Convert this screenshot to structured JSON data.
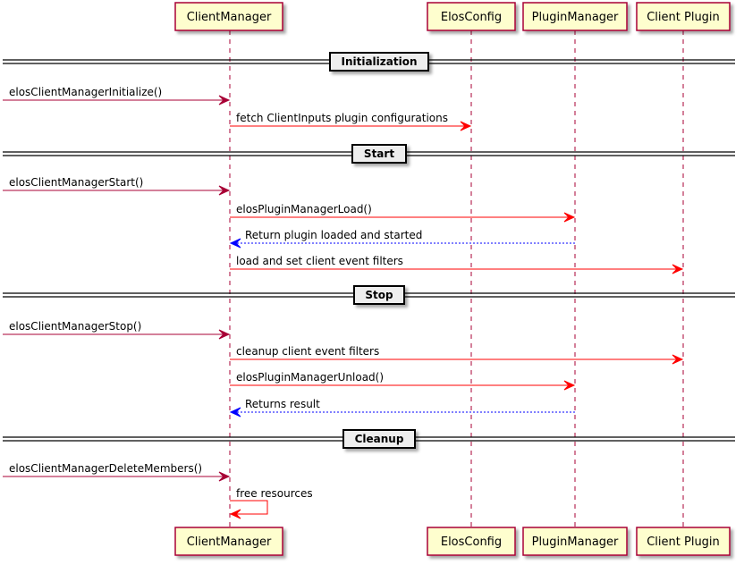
{
  "diagram": {
    "type": "sequence",
    "participants": [
      {
        "id": "cm",
        "label": "ClientManager"
      },
      {
        "id": "ec",
        "label": "ElosConfig"
      },
      {
        "id": "pm",
        "label": "PluginManager"
      },
      {
        "id": "cp",
        "label": "Client Plugin"
      }
    ],
    "colors": {
      "participant_fill": "#FEFECE",
      "participant_border": "#A80036",
      "lifeline": "#A80036",
      "external_arrow": "#A80036",
      "call_arrow": "#FF0000",
      "return_arrow": "#0000FF",
      "divider_fill": "#EEEEEE"
    },
    "steps": [
      {
        "kind": "divider",
        "label": "Initialization"
      },
      {
        "kind": "message",
        "from": "external",
        "to": "cm",
        "label": "elosClientManagerInitialize()",
        "style": "external"
      },
      {
        "kind": "message",
        "from": "cm",
        "to": "ec",
        "label": "fetch ClientInputs plugin configurations",
        "style": "call"
      },
      {
        "kind": "divider",
        "label": "Start"
      },
      {
        "kind": "message",
        "from": "external",
        "to": "cm",
        "label": "elosClientManagerStart()",
        "style": "external"
      },
      {
        "kind": "message",
        "from": "cm",
        "to": "pm",
        "label": "elosPluginManagerLoad()",
        "style": "call"
      },
      {
        "kind": "message",
        "from": "pm",
        "to": "cm",
        "label": "Return plugin loaded and started",
        "style": "return"
      },
      {
        "kind": "message",
        "from": "cm",
        "to": "cp",
        "label": "load and set client event filters",
        "style": "call"
      },
      {
        "kind": "divider",
        "label": "Stop"
      },
      {
        "kind": "message",
        "from": "external",
        "to": "cm",
        "label": "elosClientManagerStop()",
        "style": "external"
      },
      {
        "kind": "message",
        "from": "cm",
        "to": "cp",
        "label": "cleanup client event filters",
        "style": "call"
      },
      {
        "kind": "message",
        "from": "cm",
        "to": "pm",
        "label": "elosPluginManagerUnload()",
        "style": "call"
      },
      {
        "kind": "message",
        "from": "pm",
        "to": "cm",
        "label": "Returns result",
        "style": "return"
      },
      {
        "kind": "divider",
        "label": "Cleanup"
      },
      {
        "kind": "message",
        "from": "external",
        "to": "cm",
        "label": "elosClientManagerDeleteMembers()",
        "style": "external"
      },
      {
        "kind": "message",
        "from": "cm",
        "to": "cm",
        "label": "free resources",
        "style": "call"
      }
    ]
  }
}
